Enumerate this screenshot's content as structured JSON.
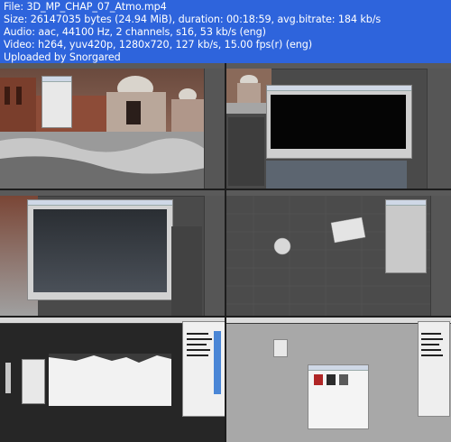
{
  "header": {
    "lines": [
      "File: 3D_MP_CHAP_07_Atmo.mp4",
      "Size: 26147035 bytes (24.94 MiB), duration: 00:18:59, avg.bitrate: 184 kb/s",
      "Audio: aac, 44100 Hz, 2 channels, s16, 53 kb/s (eng)",
      "Video: h264, yuv420p, 1280x720, 127 kb/s, 15.00 fps(r) (eng)",
      "Uploaded by Snorgared"
    ]
  },
  "thumbnails": [
    {
      "label": "thumbnail-palace-viewport"
    },
    {
      "label": "thumbnail-render-window"
    },
    {
      "label": "thumbnail-environment-dialog"
    },
    {
      "label": "thumbnail-perspective-grid"
    },
    {
      "label": "thumbnail-depth-map"
    },
    {
      "label": "thumbnail-texture-browser"
    }
  ],
  "colors": {
    "header_bg": "#2e64dc",
    "header_text": "#ffffff",
    "grid_bg": "#1d1d1d"
  }
}
